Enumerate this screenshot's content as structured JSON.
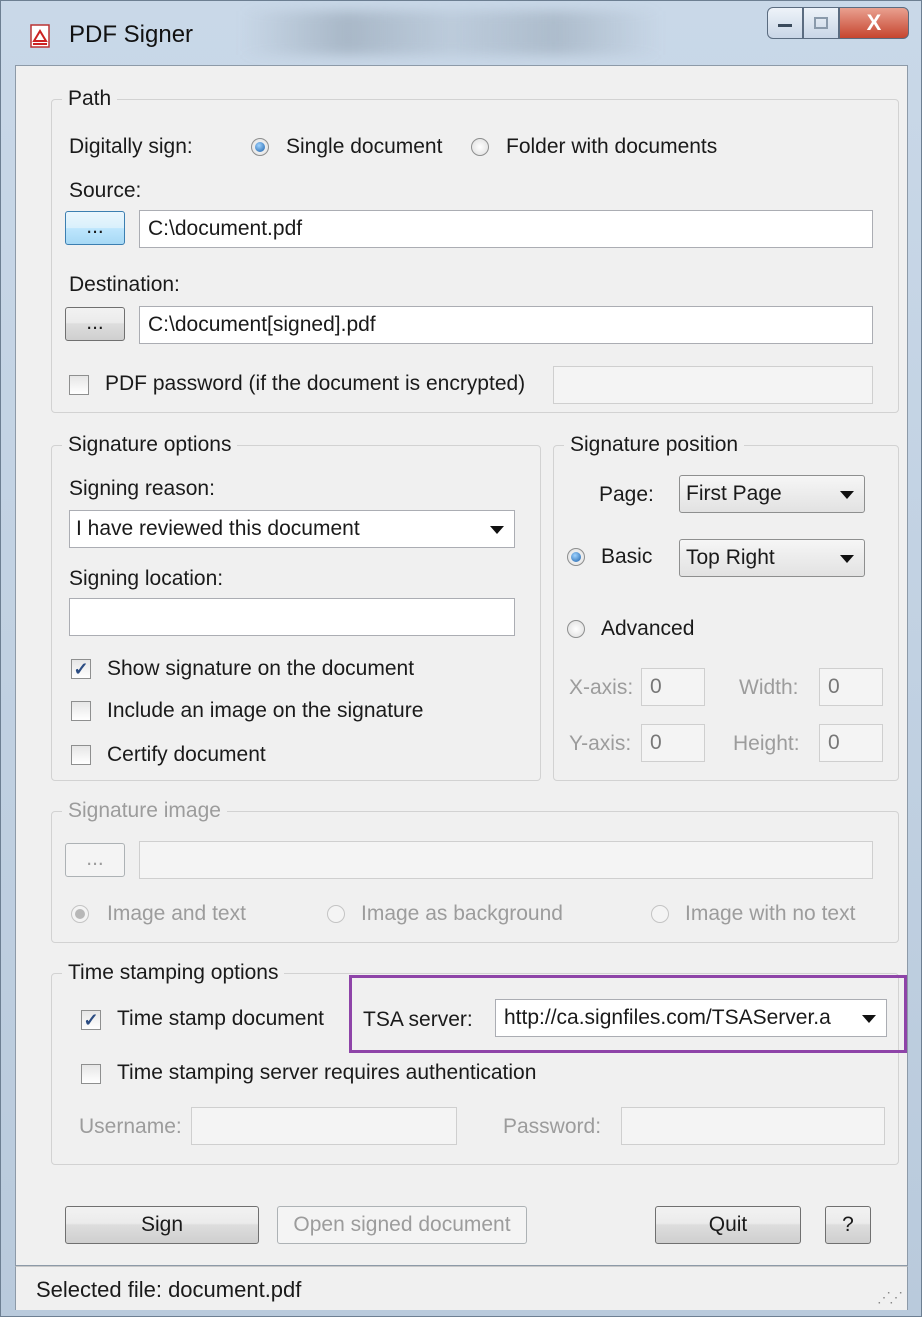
{
  "window": {
    "title": "PDF Signer",
    "close_glyph": "X"
  },
  "path": {
    "legend": "Path",
    "digitally_sign_label": "Digitally sign:",
    "single_document": "Single document",
    "folder_with_documents": "Folder with documents",
    "source_label": "Source:",
    "source_value": "C:\\document.pdf",
    "destination_label": "Destination:",
    "destination_value": "C:\\document[signed].pdf",
    "browse_label": "...",
    "pdf_password_label": "PDF password (if the document is encrypted)",
    "pdf_password_value": ""
  },
  "signature_options": {
    "legend": "Signature options",
    "signing_reason_label": "Signing reason:",
    "signing_reason_value": "I have reviewed this document",
    "signing_location_label": "Signing location:",
    "signing_location_value": "",
    "show_signature": "Show signature on the document",
    "include_image": "Include an image on the signature",
    "certify": "Certify document"
  },
  "signature_position": {
    "legend": "Signature position",
    "page_label": "Page:",
    "page_value": "First Page",
    "basic_label": "Basic",
    "basic_value": "Top Right",
    "advanced_label": "Advanced",
    "xaxis_label": "X-axis:",
    "xaxis_value": "0",
    "width_label": "Width:",
    "width_value": "0",
    "yaxis_label": "Y-axis:",
    "yaxis_value": "0",
    "height_label": "Height:",
    "height_value": "0"
  },
  "signature_image": {
    "legend": "Signature image",
    "browse_label": "...",
    "path_value": "",
    "image_and_text": "Image and text",
    "image_as_background": "Image as background",
    "image_with_no_text": "Image with no text"
  },
  "time_stamping": {
    "legend": "Time stamping options",
    "time_stamp_document": "Time stamp document",
    "tsa_server_label": "TSA server:",
    "tsa_server_value": "http://ca.signfiles.com/TSAServer.a",
    "requires_auth": "Time stamping server requires authentication",
    "username_label": "Username:",
    "username_value": "",
    "password_label": "Password:",
    "password_value": ""
  },
  "buttons": {
    "sign": "Sign",
    "open_signed": "Open signed document",
    "quit": "Quit",
    "help": "?"
  },
  "status": {
    "text": "Selected file: document.pdf"
  },
  "colors": {
    "highlight": "#8e44a8",
    "selection_accent": "#1b5fa8"
  }
}
